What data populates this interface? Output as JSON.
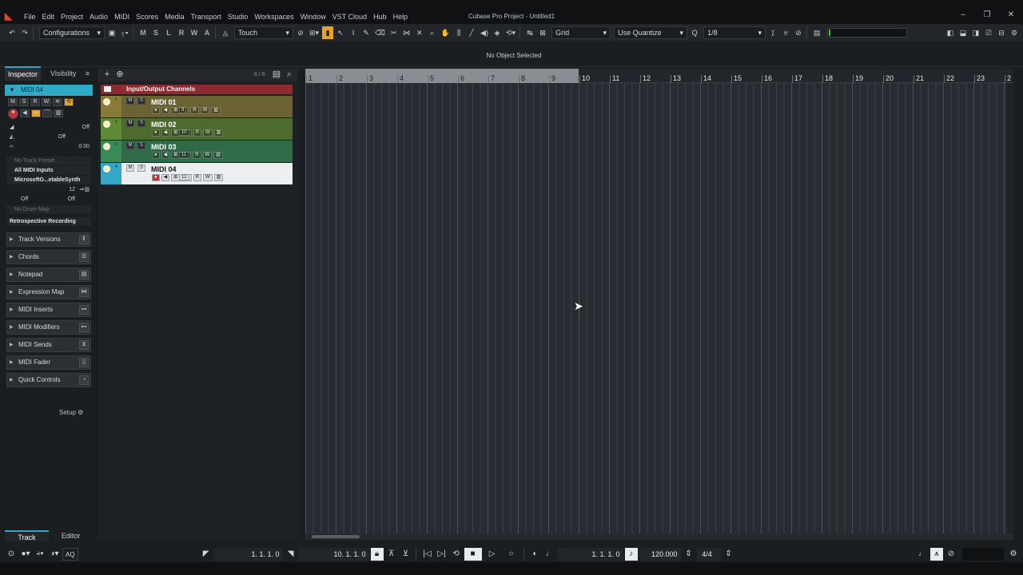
{
  "window": {
    "title": "Cubase Pro Project - Untitled1",
    "minimize_glyph": "–",
    "restore_glyph": "❐",
    "close_glyph": "✕"
  },
  "menu": [
    "File",
    "Edit",
    "Project",
    "Audio",
    "MIDI",
    "Scores",
    "Media",
    "Transport",
    "Studio",
    "Workspaces",
    "Window",
    "VST Cloud",
    "Hub",
    "Help"
  ],
  "toolbar": {
    "undo_glyph": "↶",
    "redo_glyph": "↷",
    "configurations_label": "Configurations",
    "state_buttons": [
      "M",
      "S",
      "L",
      "R",
      "W",
      "A"
    ],
    "automation_mode": "Touch",
    "snap_type": "Grid",
    "quantize_mode": "Use Quantize",
    "quantize_value": "1/8"
  },
  "infoline": {
    "text": "No Object Selected"
  },
  "inspector": {
    "tabs": [
      "Inspector",
      "Visibility"
    ],
    "track_name": "MIDI 04",
    "volume_value": "Off",
    "pan_value": "Off",
    "delay_value": "0.00",
    "track_preset": "No Track Preset",
    "input_routing": "All MIDI Inputs",
    "output_routing": "MicrosoftG...etableSynth",
    "channel": "12",
    "bank_value": "Off",
    "program_value": "Off",
    "drum_map": "No Drum Map",
    "retro_record": "Retrospective Recording",
    "sections": [
      {
        "label": "Track Versions",
        "icon": "versions-icon",
        "glyph": "⫴"
      },
      {
        "label": "Chords",
        "icon": "chords-icon",
        "glyph": "☰"
      },
      {
        "label": "Notepad",
        "icon": "notepad-icon",
        "glyph": "▤"
      },
      {
        "label": "Expression Map",
        "icon": "expression-map-icon",
        "glyph": "⋈"
      },
      {
        "label": "MIDI Inserts",
        "icon": "midi-inserts-icon",
        "glyph": "⊶"
      },
      {
        "label": "MIDI Modifiers",
        "icon": "midi-modifiers-icon",
        "glyph": "⊷"
      },
      {
        "label": "MIDI Sends",
        "icon": "midi-sends-icon",
        "glyph": "⊻"
      },
      {
        "label": "MIDI Fader",
        "icon": "midi-fader-icon",
        "glyph": "▯"
      },
      {
        "label": "Quick Controls",
        "icon": "quick-controls-icon",
        "glyph": "◔"
      }
    ],
    "setup_label": "Setup",
    "bottom_tabs": [
      "Track",
      "Editor"
    ]
  },
  "tracklist": {
    "count": "6 / 6",
    "folder_name": "Input/Output Channels",
    "tracks": [
      {
        "num": "1",
        "name": "MIDI 01",
        "channel": "9",
        "color": "#8a7a3a",
        "body": "#6b6334",
        "selected": false
      },
      {
        "num": "2",
        "name": "MIDI 02",
        "channel": "10",
        "color": "#5f8a36",
        "body": "#4d6b2e",
        "selected": false
      },
      {
        "num": "3",
        "name": "MIDI 03",
        "channel": "11",
        "color": "#3a8a58",
        "body": "#2f6b49",
        "selected": false
      },
      {
        "num": "4",
        "name": "MIDI 04",
        "channel": "12",
        "color": "#35a6c4",
        "body": "#eceef0",
        "selected": true
      }
    ]
  },
  "ruler": {
    "bars": [
      "1",
      "2",
      "3",
      "4",
      "5",
      "6",
      "7",
      "8",
      "9",
      "10",
      "11",
      "12",
      "13",
      "14",
      "15",
      "16",
      "17",
      "18",
      "19",
      "20",
      "21",
      "22",
      "23",
      "2"
    ],
    "cycle_end_bar": 10
  },
  "transport": {
    "left_locator": "1. 1. 1.   0",
    "right_locator": "10. 1. 1.   0",
    "position": "1. 1. 1.   0",
    "tempo": "120.000",
    "signature": "4/4",
    "aq_label": "AQ"
  },
  "colors": {
    "accent": "#34a4c9",
    "record": "#c6323a",
    "folder": "#8e2b32",
    "active_tool": "#e8a12b"
  }
}
